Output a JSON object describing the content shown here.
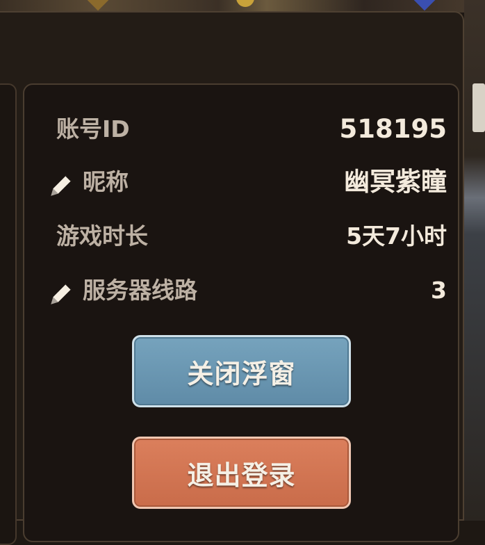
{
  "info": {
    "account_id": {
      "label": "账号ID",
      "value": "518195"
    },
    "nickname": {
      "label": "昵称",
      "value": "幽冥紫瞳",
      "edit_icon": "pencil-icon"
    },
    "play_time": {
      "label": "游戏时长",
      "value": "5天7小时"
    },
    "server_line": {
      "label": "服务器线路",
      "value": "3",
      "edit_icon": "pencil-icon"
    }
  },
  "buttons": {
    "close_float": "关闭浮窗",
    "logout": "退出登录"
  },
  "colors": {
    "close_button": "#6694b0",
    "logout_button": "#d27553",
    "panel_bg": "#1a1411",
    "label_text": "#bdb1a4",
    "value_text": "#f3eadc"
  }
}
